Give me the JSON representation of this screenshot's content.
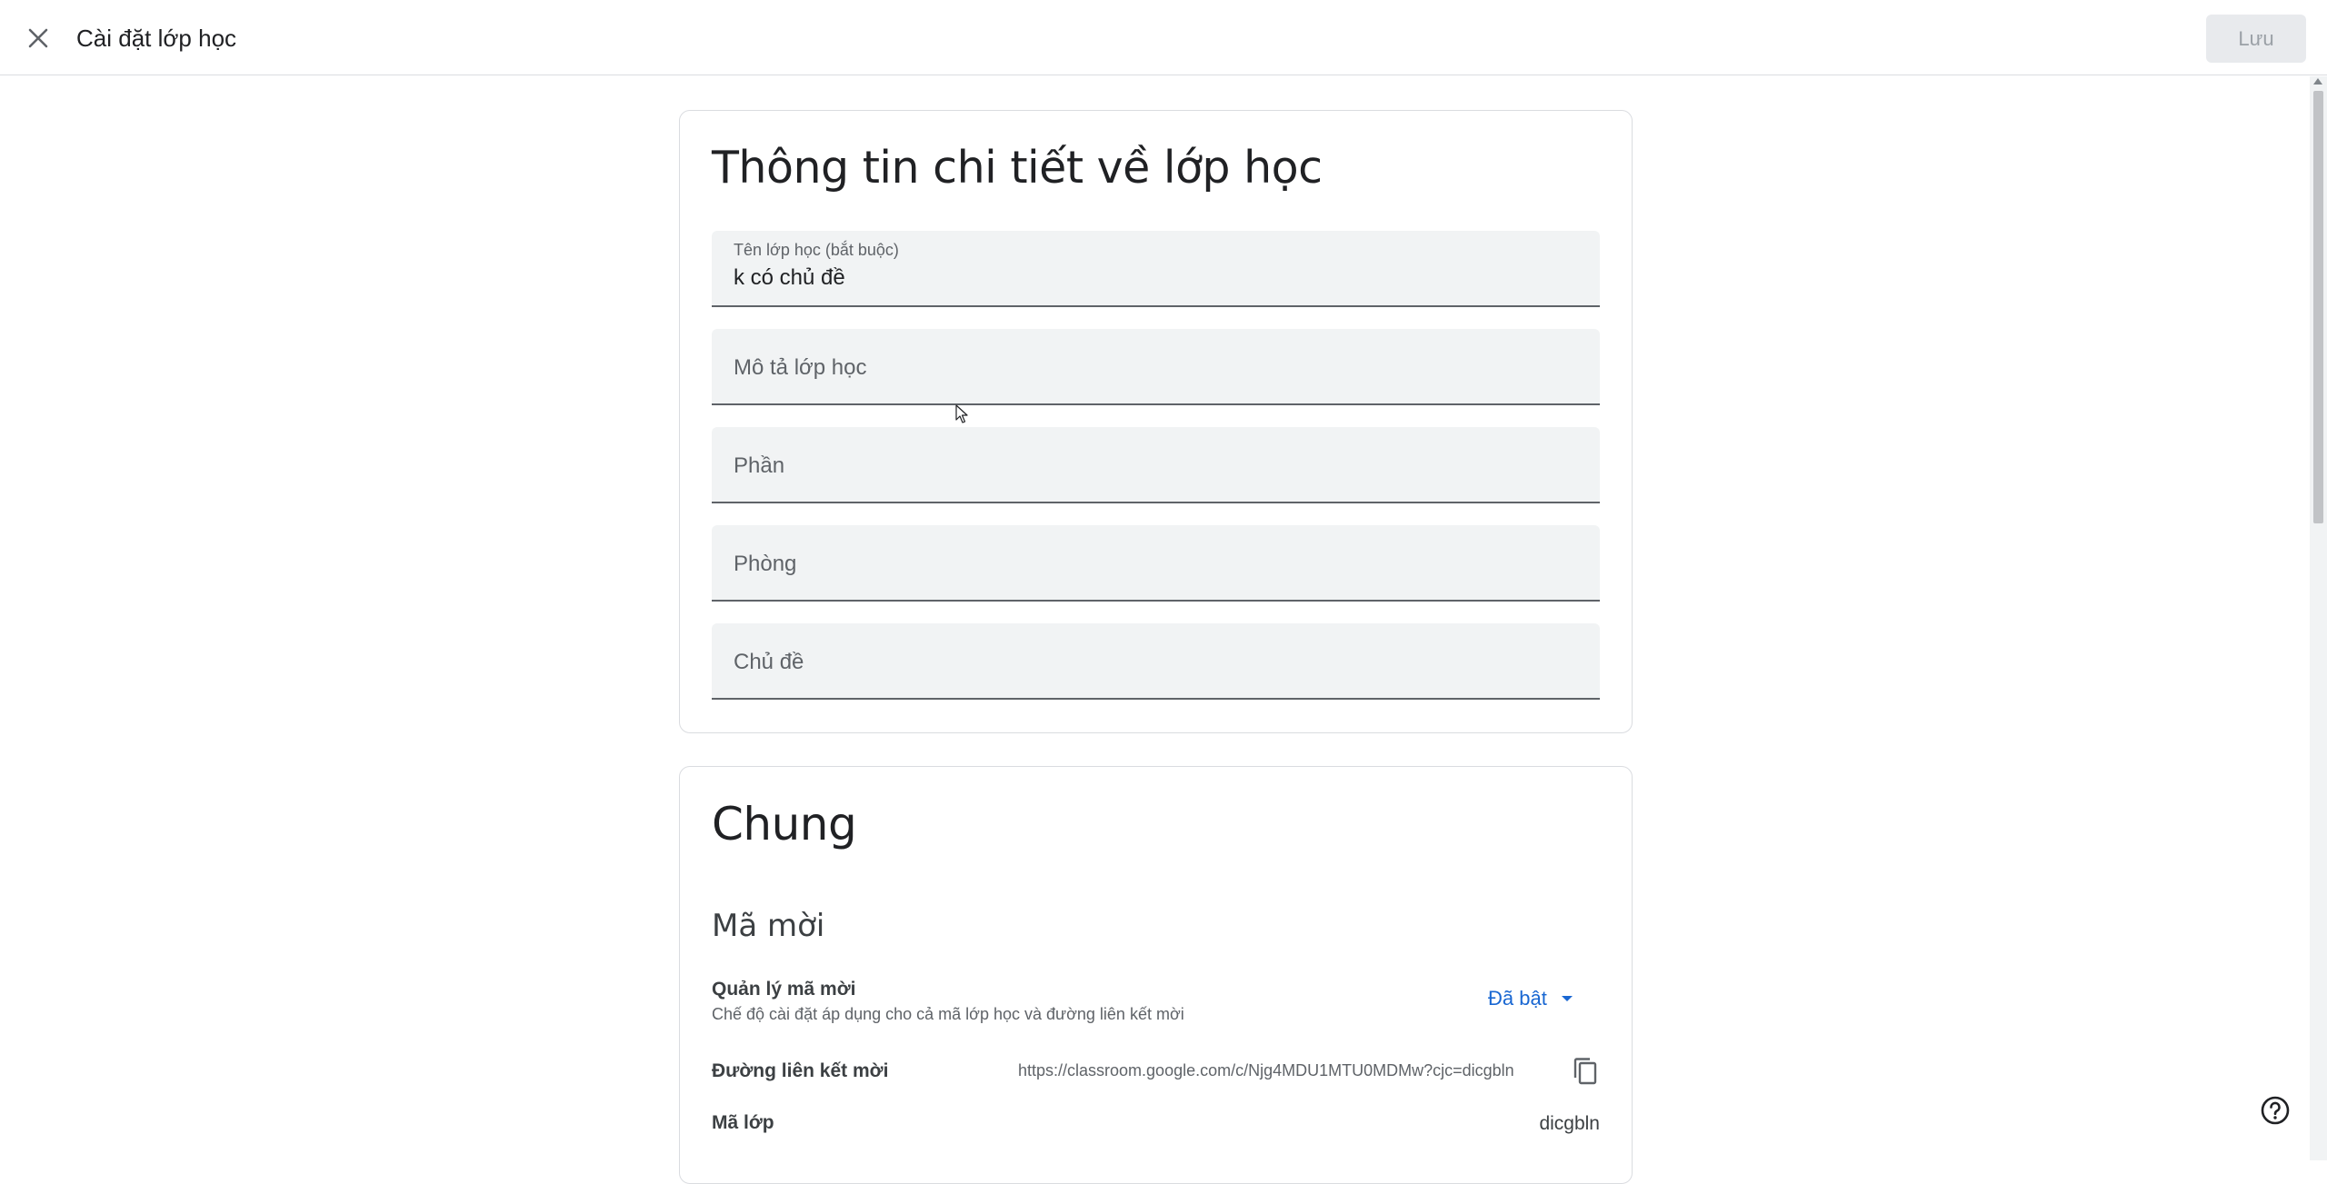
{
  "header": {
    "title": "Cài đặt lớp học",
    "save_label": "Lưu",
    "close_icon": "close-icon"
  },
  "class_details": {
    "title": "Thông tin chi tiết về lớp học",
    "fields": [
      {
        "label": "Tên lớp học (bắt buộc)",
        "value": "k có chủ đề"
      },
      {
        "placeholder": "Mô tả lớp học"
      },
      {
        "placeholder": "Phần"
      },
      {
        "placeholder": "Phòng"
      },
      {
        "placeholder": "Chủ đề"
      }
    ]
  },
  "general": {
    "title": "Chung",
    "invite_codes": {
      "heading": "Mã mời",
      "manage_label": "Quản lý mã mời",
      "manage_desc": "Chế độ cài đặt áp dụng cho cả mã lớp học và đường liên kết mời",
      "manage_value": "Đã bật",
      "link_label": "Đường liên kết mời",
      "link_value": "https://classroom.google.com/c/Njg4MDU1MTU0MDMw?cjc=dicgbln",
      "code_label": "Mã lớp",
      "code_value": "dicgbln"
    }
  },
  "colors": {
    "accent": "#1967d2",
    "border": "#dadce0",
    "field_bg": "#f1f3f4"
  }
}
